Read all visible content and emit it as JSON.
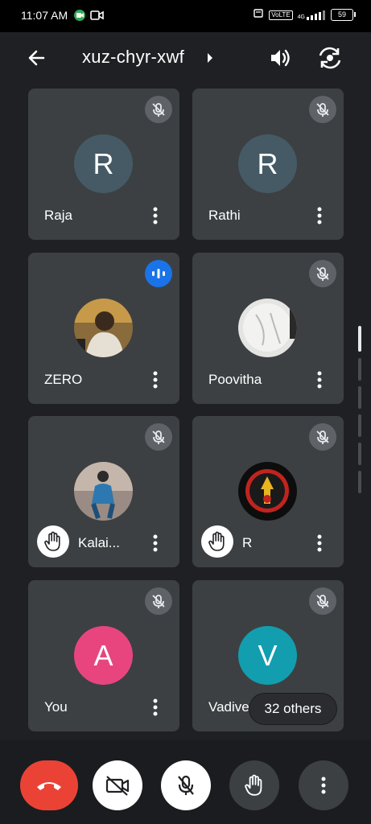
{
  "status_bar": {
    "time": "11:07 AM",
    "network_label": "VoLTE",
    "signal_label": "4G",
    "battery": "59"
  },
  "header": {
    "meeting_code": "xuz-chyr-xwf"
  },
  "participants": [
    {
      "name": "Raja",
      "initial": "R",
      "avatar_color": "#455a64",
      "mic": "muted"
    },
    {
      "name": "Rathi",
      "initial": "R",
      "avatar_color": "#455a64",
      "mic": "muted"
    },
    {
      "name": "ZERO",
      "avatar": "photo",
      "mic": "speaking"
    },
    {
      "name": "Poovitha",
      "avatar": "photo",
      "mic": "muted"
    },
    {
      "name": "Kalai...",
      "avatar": "photo",
      "mic": "muted",
      "hand_raised": true
    },
    {
      "name": "R",
      "avatar": "photo",
      "mic": "muted",
      "hand_raised": true
    },
    {
      "name": "You",
      "initial": "A",
      "avatar_color": "#e8457f",
      "mic": "muted"
    },
    {
      "name": "Vadivel",
      "initial": "V",
      "avatar_color": "#129eaf",
      "mic": "muted"
    }
  ],
  "others_label": "32 others",
  "colors": {
    "background": "#1f2023",
    "tile": "#3c4043",
    "hangup": "#ea4335",
    "speaking": "#1a73e8"
  }
}
